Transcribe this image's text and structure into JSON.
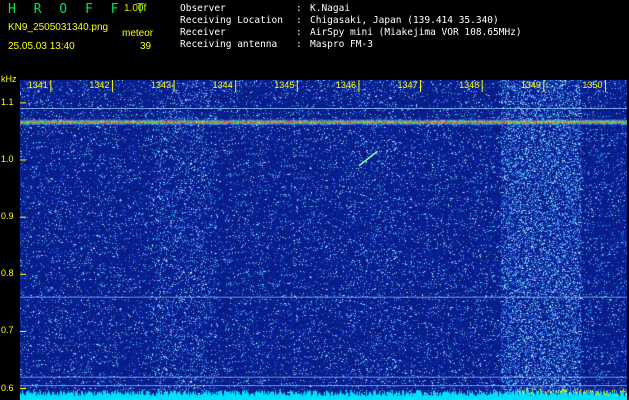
{
  "header": {
    "app_logo": "H R O F F T",
    "version": "1.00f",
    "filename": "KN9_2505031340.png",
    "meteor_label": "meteor",
    "timestamp": "25.05.03 13:40",
    "meteor_count": "39"
  },
  "info": [
    {
      "key": "Observer",
      "value": "K.Nagai"
    },
    {
      "key": "Receiving Location",
      "value": "Chigasaki, Japan (139.414 35.340)"
    },
    {
      "key": "Receiver",
      "value": "AirSpy mini (Miakejima VOR 108.65MHz)"
    },
    {
      "key": "Receiving antenna",
      "value": "Maspro FM-3"
    }
  ],
  "colors": {
    "label": "#ffff00",
    "background": "#000000",
    "spectrogram_base": "#081a8c",
    "noise_floor": "#00e0ff"
  },
  "chart_data": {
    "type": "heatmap",
    "ylabel": "kHz",
    "y_ticks": [
      "1.1",
      "1.0",
      "0.9",
      "0.8",
      "0.7",
      "0.6"
    ],
    "x_ticks": [
      "1341",
      "1342",
      "1343",
      "1344",
      "1345",
      "1346",
      "1347",
      "1348",
      "1349",
      "1350"
    ],
    "ylim": [
      0.58,
      1.14
    ],
    "xlim": [
      1340.5,
      1350.35
    ],
    "carrier_khz": 1.067,
    "reference_lines_khz": [
      1.09,
      0.76,
      0.62,
      0.605
    ],
    "meteor_echoes": [
      {
        "x_start": 1346.0,
        "x_end": 1346.3,
        "khz_start": 0.99,
        "khz_end": 1.015
      }
    ]
  }
}
